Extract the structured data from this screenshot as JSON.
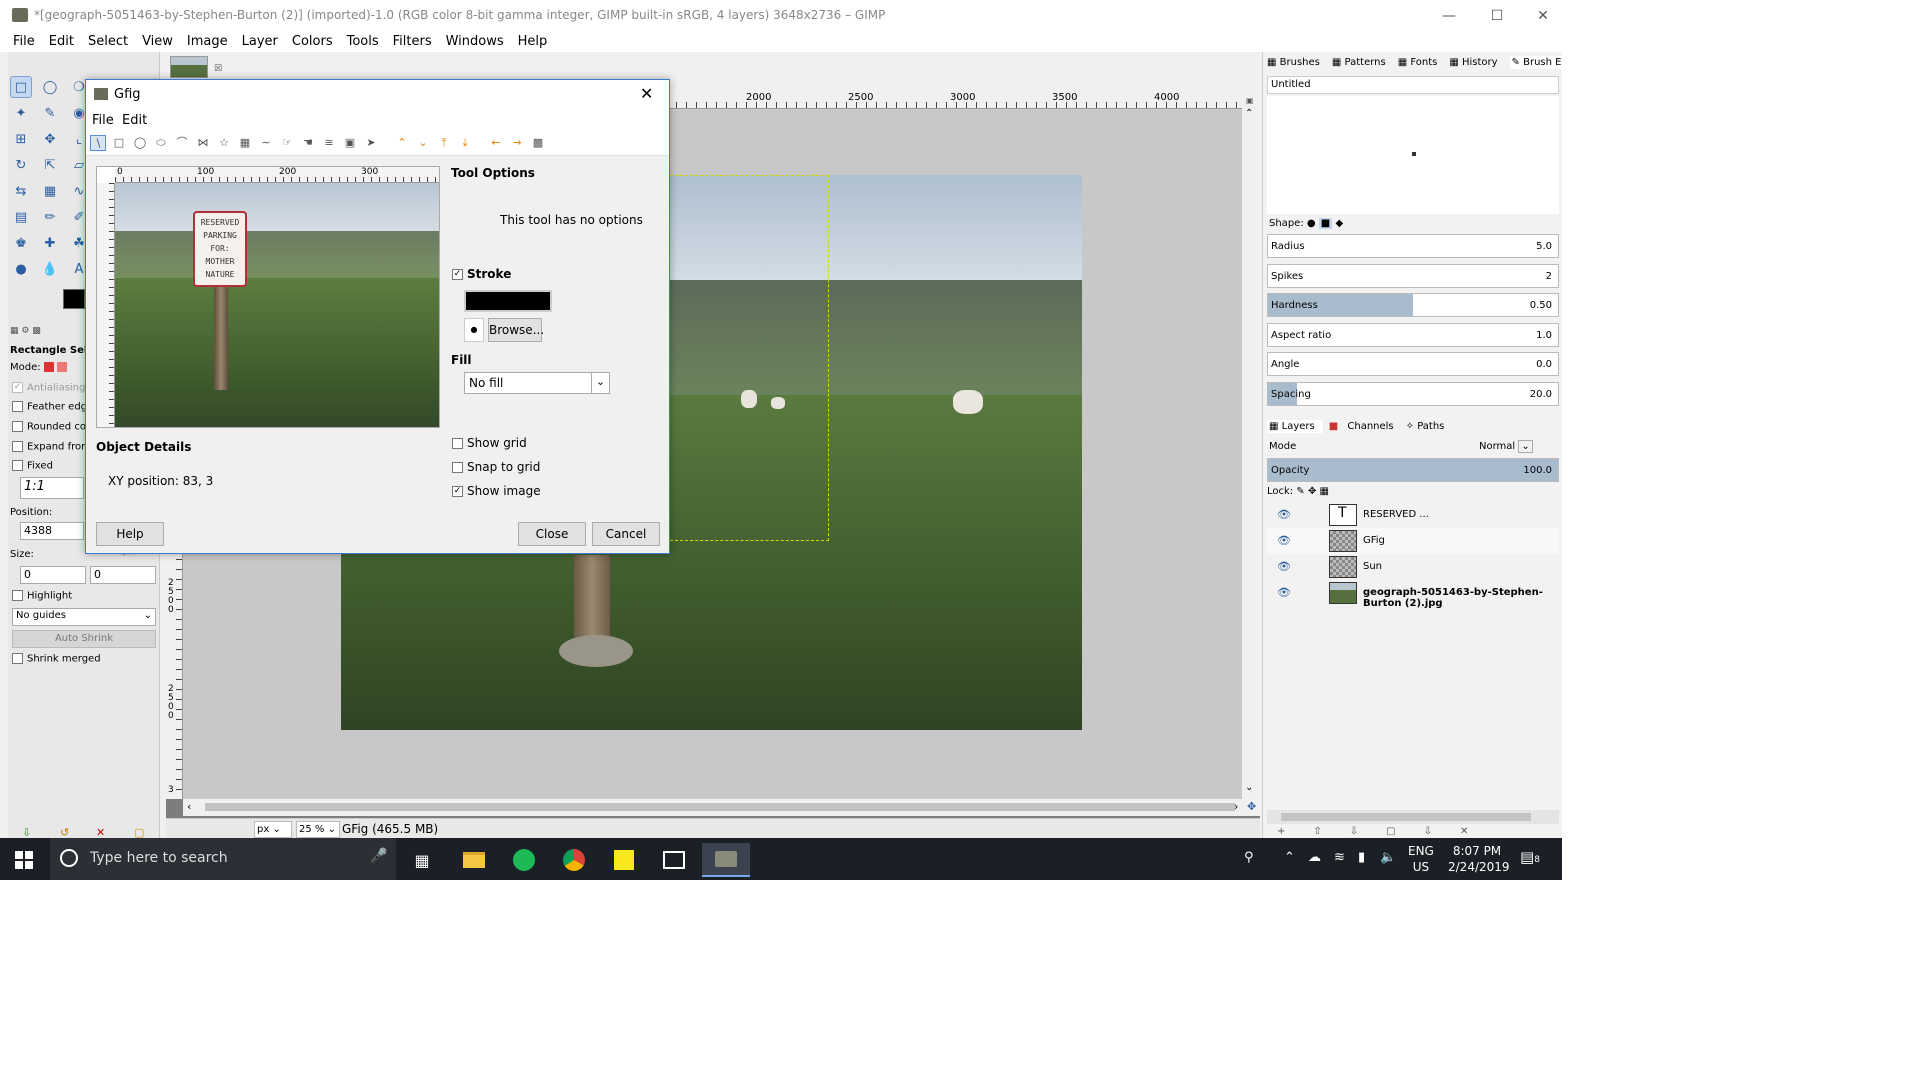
{
  "window": {
    "title": "*[geograph-5051463-by-Stephen-Burton (2)] (imported)-1.0 (RGB color 8-bit gamma integer, GIMP built-in sRGB, 4 layers) 3648x2736 – GIMP"
  },
  "menubar": [
    "File",
    "Edit",
    "Select",
    "View",
    "Image",
    "Layer",
    "Colors",
    "Tools",
    "Filters",
    "Windows",
    "Help"
  ],
  "toolbox": {
    "options_title": "Rectangle Selec",
    "mode_label": "Mode:",
    "antialiasing": "Antialiasing",
    "feather": "Feather edges",
    "rounded": "Rounded corr",
    "expand": "Expand from",
    "fixed": "Fixed",
    "ratio": "1:1",
    "position_label": "Position:",
    "position_value": "4388",
    "size_label": "Size:",
    "size_w": "0",
    "size_h": "0",
    "highlight": "Highlight",
    "guides": "No guides",
    "auto_shrink": "Auto Shrink",
    "shrink_merged": "Shrink merged",
    "unit_stub": "px"
  },
  "ruler_labels": [
    "2000",
    "2500",
    "3000",
    "3500",
    "4000"
  ],
  "ruler_v_labels": [
    "3",
    "2\n5\n0\n0"
  ],
  "statusbar": {
    "unit": "px",
    "zoom": "25 %",
    "text": "GFig (465.5 MB)"
  },
  "dock": {
    "tabs": [
      "Brushes",
      "Patterns",
      "Fonts",
      "History",
      "Brush Editor"
    ],
    "brush_name": "Untitled",
    "shape_label": "Shape:",
    "params": [
      {
        "label": "Radius",
        "value": "5.0",
        "fill": 0.0
      },
      {
        "label": "Spikes",
        "value": "2",
        "fill": 0.0
      },
      {
        "label": "Hardness",
        "value": "0.50",
        "fill": 0.5
      },
      {
        "label": "Aspect ratio",
        "value": "1.0",
        "fill": 0.0
      },
      {
        "label": "Angle",
        "value": "0.0",
        "fill": 0.0
      },
      {
        "label": "Spacing",
        "value": "20.0",
        "fill": 0.1
      }
    ],
    "layer_tabs": [
      "Layers",
      "Channels",
      "Paths"
    ],
    "mode_label": "Mode",
    "mode_value": "Normal",
    "opacity_label": "Opacity",
    "opacity_value": "100.0",
    "lock_label": "Lock:",
    "layers": [
      {
        "name": "RESERVED ...",
        "bold": false
      },
      {
        "name": "GFig",
        "bold": false
      },
      {
        "name": "Sun",
        "bold": false
      },
      {
        "name": "geograph-5051463-by-Stephen-Burton (2).jpg",
        "bold": true
      }
    ]
  },
  "dialog": {
    "title": "Gfig",
    "menu": [
      "File",
      "Edit"
    ],
    "ruler_labels": [
      "0",
      "100",
      "200",
      "300"
    ],
    "preview_sign": [
      "RESERVED",
      "PARKING",
      "FOR:",
      "MOTHER",
      "NATURE"
    ],
    "tool_options_title": "Tool Options",
    "no_options": "This tool has no options",
    "stroke_label": "Stroke",
    "browse_label": "Browse...",
    "fill_label": "Fill",
    "fill_value": "No fill",
    "show_grid": "Show grid",
    "snap_to_grid": "Snap to grid",
    "show_image": "Show image",
    "object_details": "Object Details",
    "xy_position": "XY position: 83, 3",
    "help": "Help",
    "close": "Close",
    "cancel": "Cancel"
  },
  "taskbar": {
    "search_placeholder": "Type here to search",
    "lang": "ENG",
    "region": "US",
    "time": "8:07 PM",
    "date": "2/24/2019",
    "notif_count": "8"
  },
  "colors": {
    "accent": "#3a7bd5",
    "taskbar": "#1b1f26",
    "slider_fill": "#a9bccd"
  }
}
